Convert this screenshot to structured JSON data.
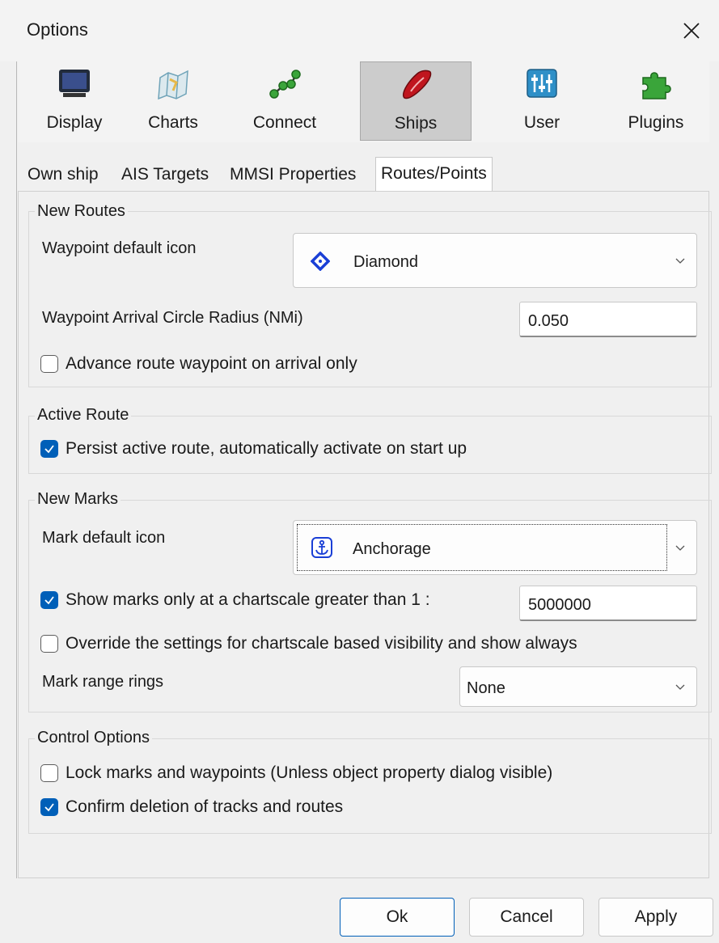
{
  "window": {
    "title": "Options"
  },
  "toolbar": {
    "items": [
      {
        "label": "Display",
        "icon": "monitor-icon"
      },
      {
        "label": "Charts",
        "icon": "charts-icon"
      },
      {
        "label": "Connect",
        "icon": "connect-icon"
      },
      {
        "label": "Ships",
        "icon": "ship-icon",
        "active": true
      },
      {
        "label": "User",
        "icon": "sliders-icon"
      },
      {
        "label": "Plugins",
        "icon": "puzzle-icon"
      }
    ]
  },
  "tabs": [
    {
      "label": "Own ship"
    },
    {
      "label": "AIS Targets"
    },
    {
      "label": "MMSI Properties"
    },
    {
      "label": "Routes/Points",
      "active": true
    }
  ],
  "new_routes": {
    "title": "New Routes",
    "waypoint_icon_label": "Waypoint default icon",
    "waypoint_icon_value": "Diamond",
    "arrival_radius_label": "Waypoint Arrival Circle Radius (NMi)",
    "arrival_radius_value": "0.050",
    "advance_label": "Advance route waypoint on arrival only",
    "advance_checked": false
  },
  "active_route": {
    "title": "Active Route",
    "persist_label": "Persist active route, automatically activate on start up",
    "persist_checked": true
  },
  "new_marks": {
    "title": "New Marks",
    "mark_icon_label": "Mark default icon",
    "mark_icon_value": "Anchorage",
    "show_marks_label": "Show marks only at a chartscale greater than 1 :",
    "show_marks_checked": true,
    "chartscale_value": "5000000",
    "override_label": "Override the settings for chartscale based visibility and show always",
    "override_checked": false,
    "range_rings_label": "Mark range rings",
    "range_rings_value": "None"
  },
  "control_options": {
    "title": "Control Options",
    "lock_label": "Lock marks and waypoints (Unless object property dialog visible)",
    "lock_checked": false,
    "confirm_label": "Confirm deletion of tracks and routes",
    "confirm_checked": true
  },
  "buttons": {
    "ok": "Ok",
    "cancel": "Cancel",
    "apply": "Apply"
  },
  "colors": {
    "accent": "#005fb8",
    "diamond": "#1a3fd6",
    "ship": "#c0161e"
  }
}
